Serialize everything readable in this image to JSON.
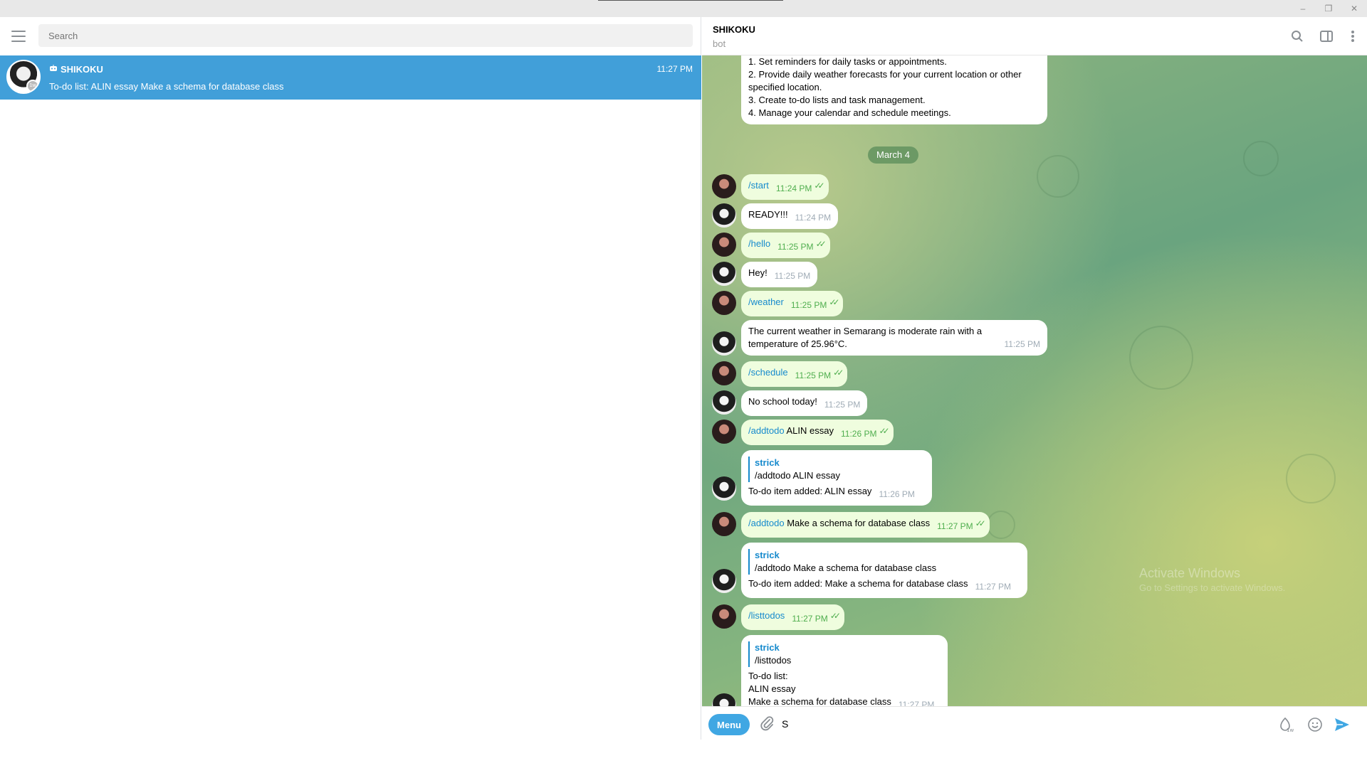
{
  "window": {
    "controls": {
      "minimize": "–",
      "maximize": "❐",
      "close": "✕"
    }
  },
  "sidebar": {
    "search_placeholder": "Search",
    "chat": {
      "name": "SHIKOKU",
      "time": "11:27 PM",
      "preview": "To-do list: ALIN essay Make a schema for database class",
      "avatar_badge": "1w"
    }
  },
  "chat": {
    "title": "SHIKOKU",
    "status": "bot",
    "intro_lines": [
      "1. Set reminders for daily tasks or appointments.",
      "2. Provide daily weather forecasts for your current location or other specified location.",
      "3. Create to-do lists and task management.",
      "4. Manage your calendar and schedule meetings."
    ],
    "date_separator": "March 4",
    "messages": [
      {
        "cmd": "/start",
        "text": "",
        "time": "11:24 PM"
      },
      {
        "text": "READY!!!",
        "time": "11:24 PM"
      },
      {
        "cmd": "/hello",
        "text": "",
        "time": "11:25 PM"
      },
      {
        "text": "Hey!",
        "time": "11:25 PM"
      },
      {
        "cmd": "/weather",
        "text": "",
        "time": "11:25 PM"
      },
      {
        "text_line1": "The current weather in Semarang is moderate rain with a",
        "text_line2": "temperature of 25.96°C.",
        "time": "11:25 PM"
      },
      {
        "cmd": "/schedule",
        "text": "",
        "time": "11:25 PM"
      },
      {
        "text": "No school today!",
        "time": "11:25 PM"
      },
      {
        "cmd": "/addtodo",
        "text": " ALIN essay",
        "time": "11:26 PM"
      },
      {
        "reply_name": "strick",
        "reply_text": "/addtodo ALIN essay",
        "text": "To-do item added: ALIN essay",
        "time": "11:26 PM"
      },
      {
        "cmd": "/addtodo",
        "text": " Make a schema for database class",
        "time": "11:27 PM"
      },
      {
        "reply_name": "strick",
        "reply_text": "/addtodo Make a schema for database class",
        "text": "To-do item added: Make a schema for database class",
        "time": "11:27 PM"
      },
      {
        "cmd": "/listtodos",
        "text": "",
        "time": "11:27 PM"
      },
      {
        "reply_name": "strick",
        "reply_text": "/listtodos",
        "line1": "To-do list:",
        "line2": "ALIN essay",
        "line3": "Make a schema for database class",
        "time": "11:27 PM"
      }
    ],
    "watermark_title": "Activate Windows",
    "watermark_sub": "Go to Settings to activate Windows."
  },
  "composer": {
    "menu_label": "Menu",
    "input_value": "S",
    "emoji_badge": "1w"
  },
  "colors": {
    "accent": "#419fd9",
    "outgoing_bubble": "#effdde",
    "link": "#168acd",
    "check": "#4fae4e"
  }
}
